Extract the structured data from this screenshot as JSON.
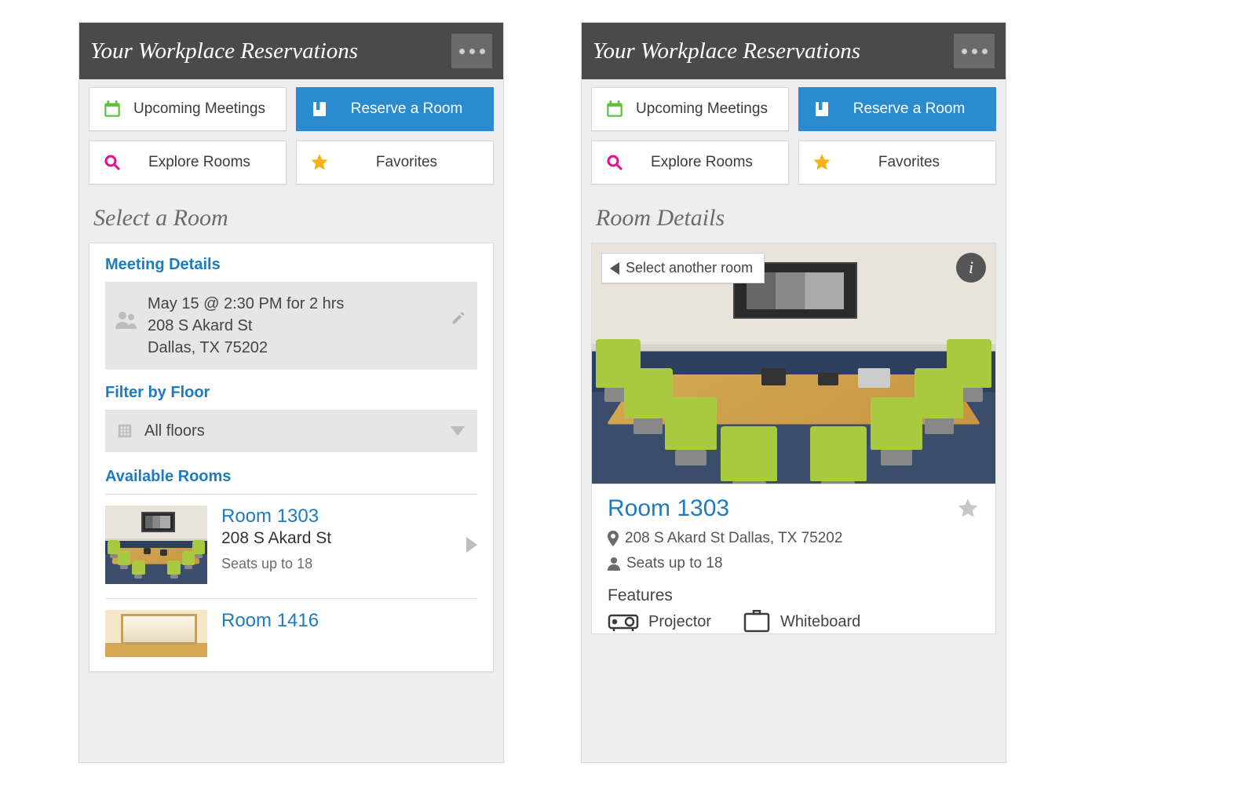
{
  "header": {
    "title": "Your Workplace Reservations"
  },
  "tiles": {
    "upcoming": "Upcoming Meetings",
    "reserve": "Reserve a Room",
    "explore": "Explore Rooms",
    "favorites": "Favorites"
  },
  "left": {
    "section": "Select a Room",
    "meeting_details": {
      "heading": "Meeting Details",
      "when": "May 15 @ 2:30 PM for 2 hrs",
      "addr1": "208 S Akard St",
      "addr2": "Dallas, TX 75202"
    },
    "filter": {
      "heading": "Filter by Floor",
      "value": "All floors"
    },
    "available": {
      "heading": "Available Rooms",
      "rooms": [
        {
          "name": "Room 1303",
          "addr": "208 S Akard St",
          "seats": "Seats up to 18"
        },
        {
          "name": "Room 1416",
          "addr": "",
          "seats": ""
        }
      ]
    }
  },
  "right": {
    "section": "Room Details",
    "back": "Select another room",
    "room": {
      "name": "Room 1303",
      "addr": "208 S Akard St Dallas, TX 75202",
      "seats": "Seats up to 18",
      "features_heading": "Features",
      "features": {
        "projector": "Projector",
        "whiteboard": "Whiteboard"
      }
    }
  }
}
